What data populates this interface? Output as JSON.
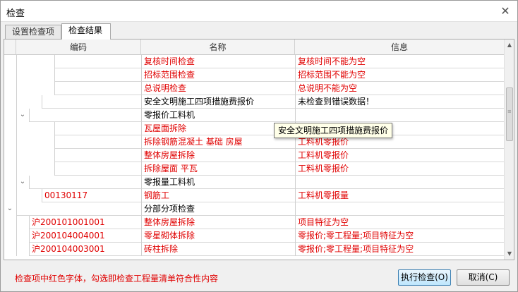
{
  "window": {
    "title": "检查"
  },
  "tabs": [
    {
      "label": "设置检查项"
    },
    {
      "label": "检查结果"
    }
  ],
  "columns": [
    "编码",
    "名称",
    "信息"
  ],
  "rows": [
    {
      "code": "",
      "name": "复核时间检查",
      "info": "复核时间不能为空",
      "red": true
    },
    {
      "code": "",
      "name": "招标范围检查",
      "info": "招标范围不能为空",
      "red": true
    },
    {
      "code": "",
      "name": "总说明检查",
      "info": "总说明不能为空",
      "red": true
    },
    {
      "code": "",
      "name": "安全文明施工四项措施费报价",
      "info": "未检查到错误数据！",
      "red": false
    },
    {
      "code": "",
      "name": "零报价工料机",
      "info": "",
      "red": false
    },
    {
      "code": "",
      "name": "瓦屋面拆除",
      "info": "",
      "red": true
    },
    {
      "code": "",
      "name": "拆除钢筋混凝土 基础 房屋",
      "info": "工料机零报价",
      "red": true
    },
    {
      "code": "",
      "name": "整体房屋拆除",
      "info": "工料机零报价",
      "red": true
    },
    {
      "code": "",
      "name": "拆除屋面 平瓦",
      "info": "工料机零报价",
      "red": true
    },
    {
      "code": "",
      "name": "零报量工料机",
      "info": "",
      "red": false
    },
    {
      "code": "00130117",
      "name": "钢筋工",
      "info": "工料机零报量",
      "red": true
    },
    {
      "code": "",
      "name": "分部分项检查",
      "info": "",
      "red": false
    },
    {
      "code": "沪200101001001",
      "name": "整体房屋拆除",
      "info": "项目特征为空",
      "red": true
    },
    {
      "code": "沪200104004001",
      "name": "零星砌体拆除",
      "info": "零报价;零工程量;项目特征为空",
      "red": true
    },
    {
      "code": "沪200104003001",
      "name": "砖柱拆除",
      "info": "零报价;零工程量;项目特征为空",
      "red": true
    }
  ],
  "tooltip": "安全文明施工四项措施费报价",
  "note": "检查项中红色字体，勾选即检查工程量清单符合性内容",
  "buttons": {
    "run": "执行检查(O)",
    "cancel": "取消(C)"
  }
}
